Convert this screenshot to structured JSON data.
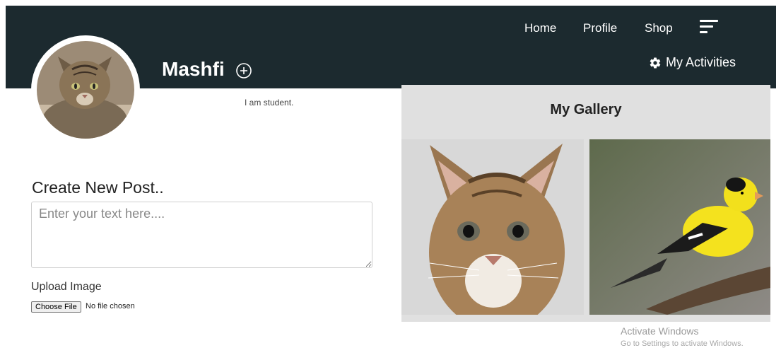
{
  "nav": {
    "links": [
      "Home",
      "Profile",
      "Shop"
    ],
    "menu_icon": "hamburger-menu-icon"
  },
  "activities": {
    "label": "My Activities",
    "icon": "gear-icon"
  },
  "profile": {
    "name": "Mashfi",
    "bio": "I am student.",
    "add_icon": "plus-circle-icon",
    "avatar": "cat-avatar"
  },
  "post": {
    "title": "Create New Post..",
    "placeholder": "Enter your text here....",
    "upload_label": "Upload Image",
    "file_button": "Choose File",
    "file_status": "No file chosen"
  },
  "gallery": {
    "title": "My Gallery",
    "images": [
      "kitten-photo",
      "goldfinch-bird-photo"
    ]
  },
  "watermark": {
    "line1": "Activate Windows",
    "line2": "Go to Settings to activate Windows."
  },
  "colors": {
    "header": "#1c2a2f",
    "gallery_bg": "#e0e0e0"
  }
}
